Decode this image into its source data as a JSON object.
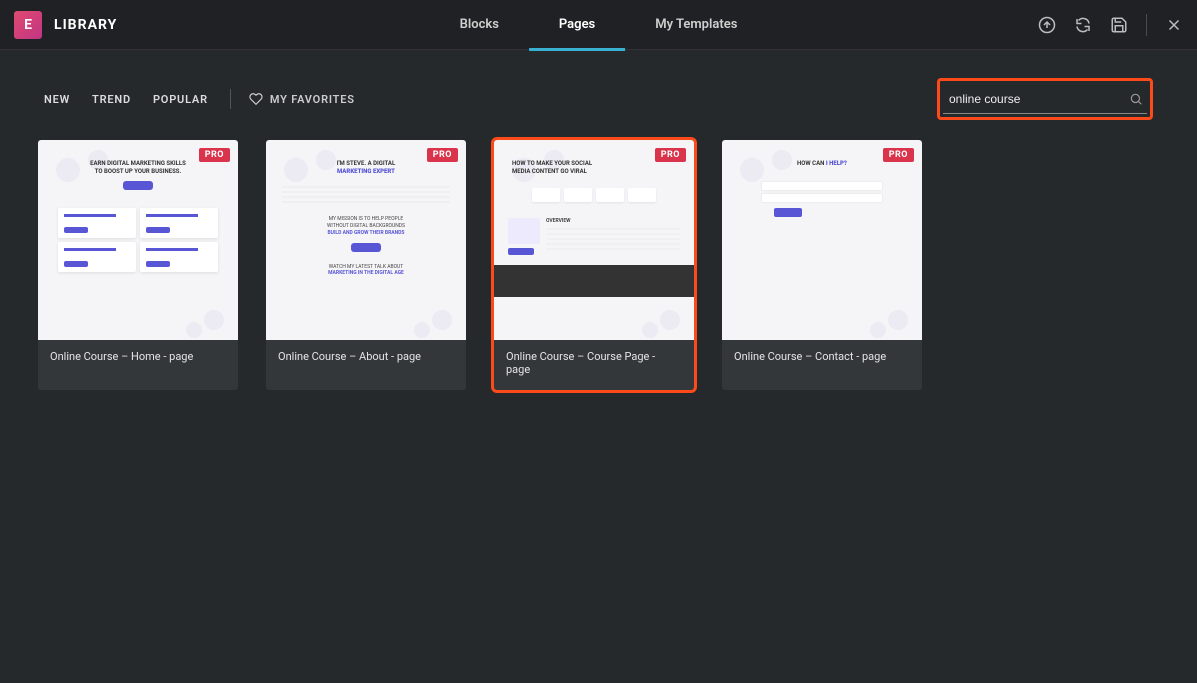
{
  "header": {
    "library_label": "LIBRARY",
    "tabs": {
      "blocks": "Blocks",
      "pages": "Pages",
      "my_templates": "My Templates"
    }
  },
  "filters": {
    "new": "NEW",
    "trend": "TREND",
    "popular": "POPULAR",
    "favorites": "MY FAVORITES"
  },
  "search": {
    "value": "online course"
  },
  "badge": {
    "pro": "PRO"
  },
  "templates": [
    {
      "title": "Online Course – Home - page",
      "thumb": {
        "headline_1": "EARN DIGITAL MARKETING SKILLS",
        "headline_2": "TO BOOST UP YOUR BUSINESS."
      }
    },
    {
      "title": "Online Course – About - page",
      "thumb": {
        "headline_1": "I'M STEVE. A DIGITAL",
        "headline_2": "MARKETING EXPERT",
        "sub_1": "MY MISSION IS TO HELP PEOPLE",
        "sub_2": "WITHOUT DIGITAL BACKGROUNDS",
        "sub_3": "BUILD AND GROW THEIR BRANDS",
        "talk_1": "WATCH MY LATEST TALK ABOUT",
        "talk_2": "MARKETING IN THE DIGITAL AGE"
      }
    },
    {
      "title": "Online Course – Course Page - page",
      "thumb": {
        "headline_1": "HOW TO MAKE YOUR SOCIAL",
        "headline_2": "MEDIA CONTENT GO VIRAL",
        "overview": "OVERVIEW"
      }
    },
    {
      "title": "Online Course – Contact - page",
      "thumb": {
        "headline_1": "HOW CAN I HELP?"
      }
    }
  ]
}
